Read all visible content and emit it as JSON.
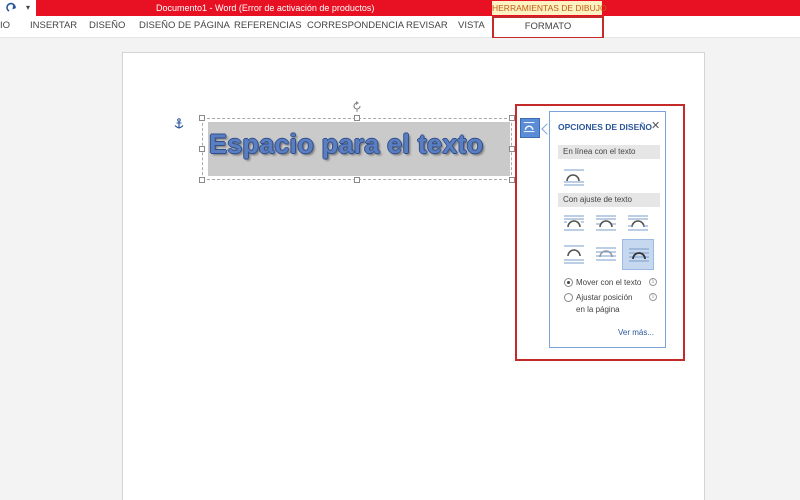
{
  "titlebar": {
    "qat_dropdown": "▾",
    "document_title": "Documento1 -  Word (Error de activación de productos)",
    "tools_group_label": "HERRAMIENTAS DE DIBUJO"
  },
  "ribbon": {
    "tabs": [
      {
        "label": "IO"
      },
      {
        "label": "INSERTAR"
      },
      {
        "label": "DISEÑO"
      },
      {
        "label": "DISEÑO DE PÁGINA"
      },
      {
        "label": "REFERENCIAS"
      },
      {
        "label": "CORRESPONDENCIA"
      },
      {
        "label": "REVISAR"
      },
      {
        "label": "VISTA"
      }
    ],
    "active_tab": "FORMATO"
  },
  "document": {
    "textbox_text": "Espacio para el texto"
  },
  "layout_panel": {
    "title": "OPCIONES DE DISEÑO",
    "close": "✕",
    "inline_header": "En línea con el texto",
    "wrap_header": "Con ajuste de texto",
    "radio_move": "Mover con el texto",
    "radio_fix_line1": "Ajustar posición",
    "radio_fix_line2": "en la página",
    "info": "i",
    "see_more": "Ver más..."
  },
  "colors": {
    "titlebar": "#e81123",
    "highlight": "#c42a2a",
    "accent": "#2b579a"
  }
}
